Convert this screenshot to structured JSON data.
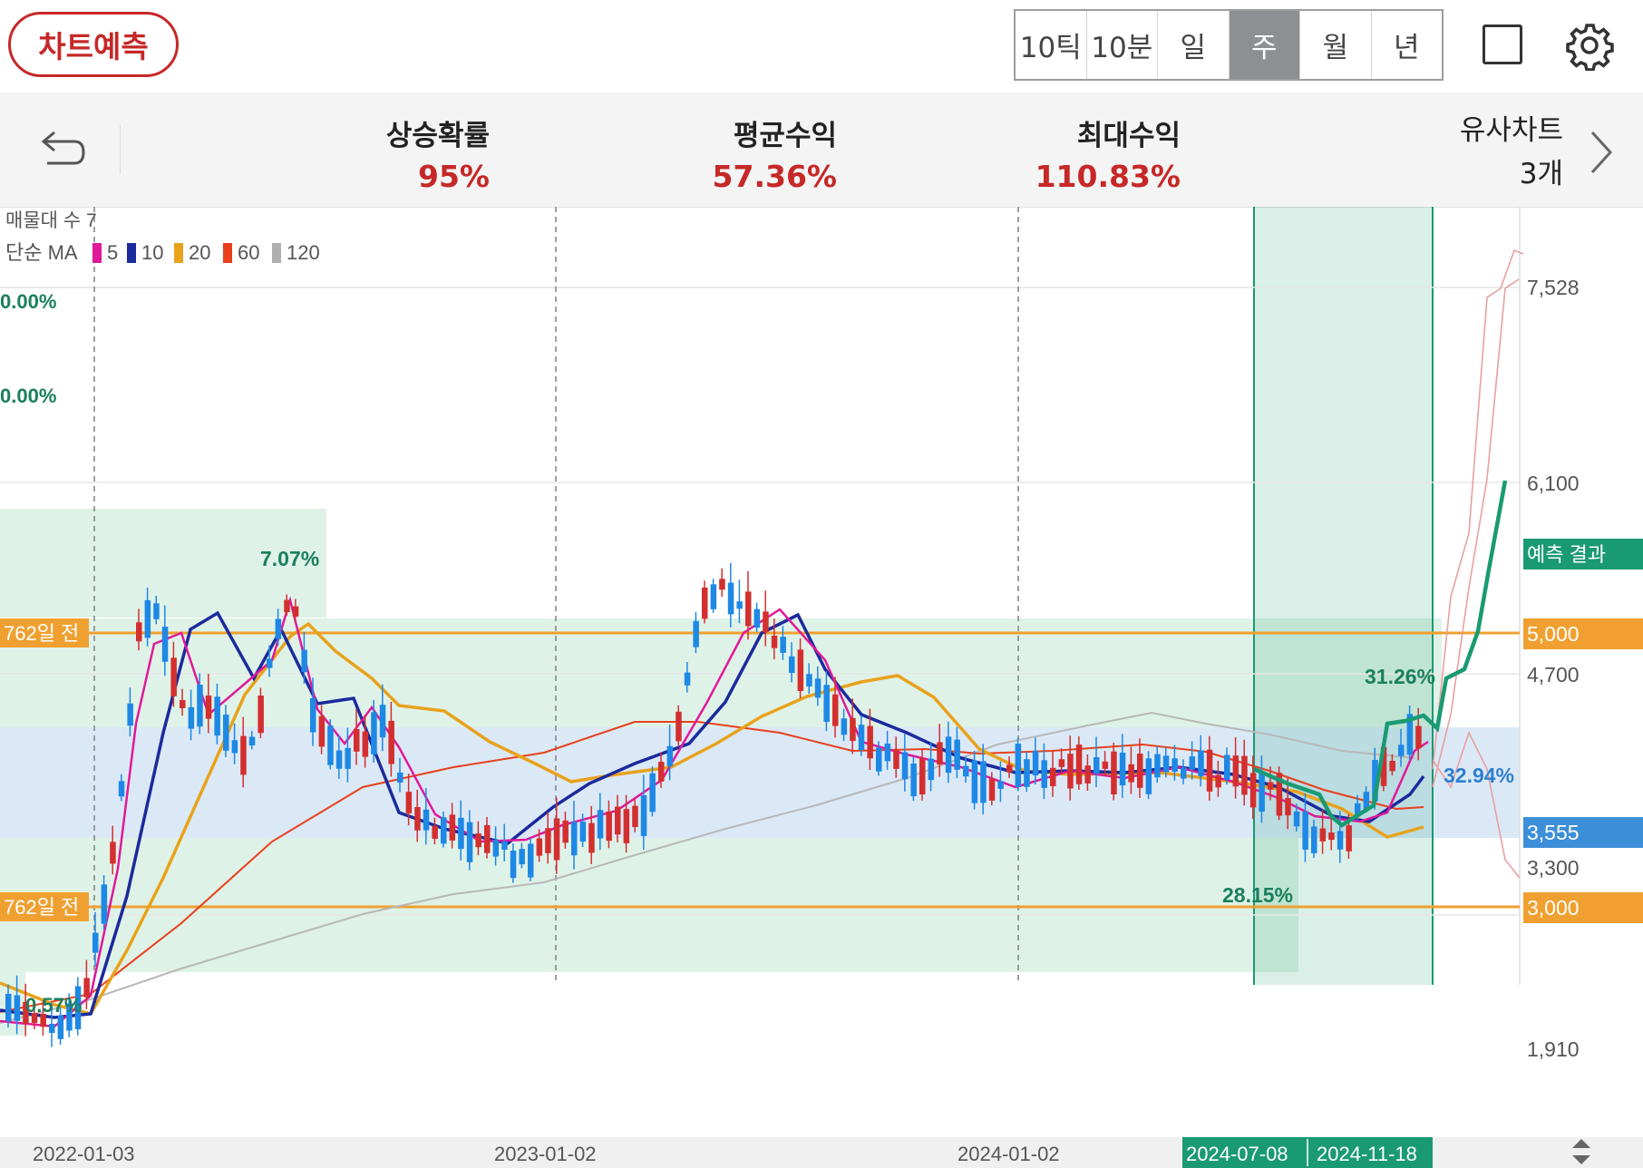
{
  "header": {
    "predict_button": "차트예측",
    "periods": [
      "10틱",
      "10분",
      "일",
      "주",
      "월",
      "년"
    ],
    "active_period": "주"
  },
  "stats": {
    "rise_prob_label": "상승확률",
    "rise_prob_value": "95%",
    "avg_return_label": "평균수익",
    "avg_return_value": "57.36%",
    "max_return_label": "최대수익",
    "max_return_value": "110.83%",
    "similar_label": "유사차트",
    "similar_value": "3개"
  },
  "legend": {
    "volume_profile": "매물대 수 7",
    "ma_prefix": "단순 MA",
    "ma": [
      {
        "label": "5",
        "color": "#e0199a"
      },
      {
        "label": "10",
        "color": "#1b2a9c"
      },
      {
        "label": "20",
        "color": "#e8a21b"
      },
      {
        "label": "60",
        "color": "#e8401b"
      },
      {
        "label": "120",
        "color": "#b0b0b0"
      }
    ]
  },
  "price_axis": [
    "7,528",
    "6,100",
    "4,700",
    "1,910"
  ],
  "badges": {
    "predict_result": "예측 결과",
    "level_5000": "5,000",
    "level_3555": "3,555",
    "level_3300": "3,300",
    "level_3000": "3,000",
    "days_label_top": "762일 전",
    "days_label_bottom": "762일 전"
  },
  "percent_labels": {
    "p1": "0.00%",
    "p2": "0.00%",
    "p3": "7.07%",
    "p4": "0.57%",
    "p5": "31.26%",
    "p6": "32.94%",
    "p7": "28.15%"
  },
  "date_axis": {
    "d1": "2022-01-03",
    "d2": "2023-01-02",
    "d3": "2024-01-02",
    "d4": "2024-07-08",
    "d5": "2024-11-18"
  },
  "colors": {
    "up": "#d32f2f",
    "down": "#1e88e5",
    "prediction": "#1a9a72",
    "level_orange": "#f0a030",
    "level_blue": "#3d8fd9",
    "zone_green": "#dff2e8",
    "zone_blue": "#dbe9f7"
  }
}
